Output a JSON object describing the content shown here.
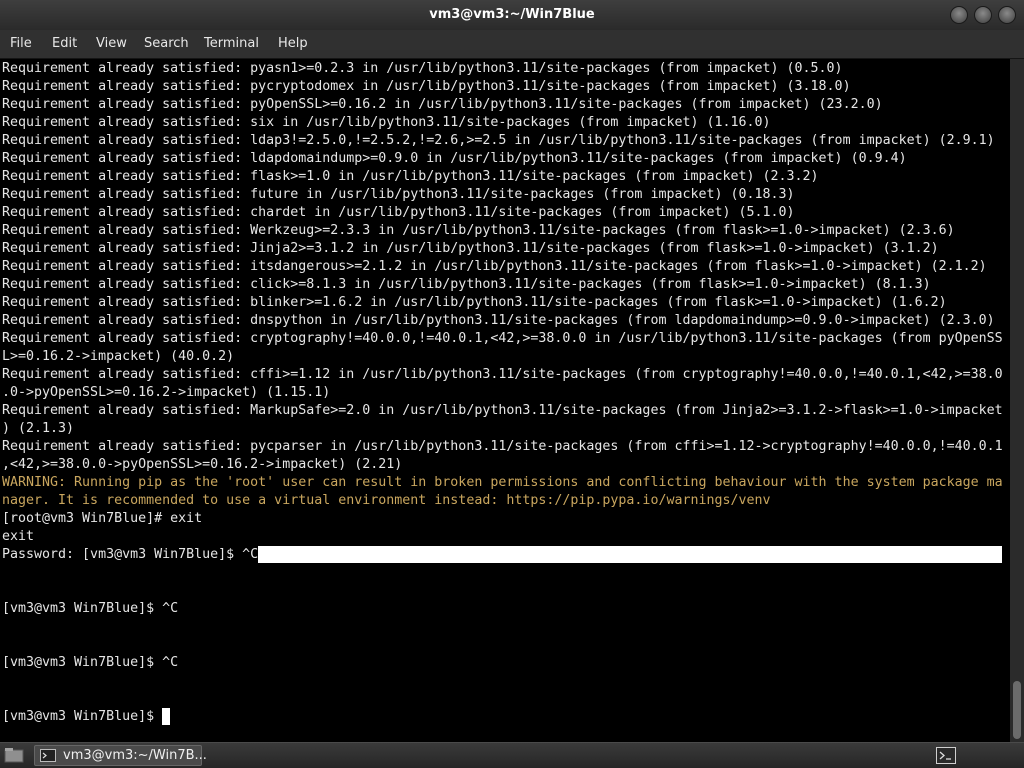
{
  "window": {
    "title": "vm3@vm3:~/Win7Blue",
    "buttons": [
      "minimize-icon",
      "maximize-icon",
      "close-icon"
    ]
  },
  "menu": {
    "items": [
      "File",
      "Edit",
      "View",
      "Search",
      "Terminal",
      "Help"
    ]
  },
  "terminal": {
    "lines": [
      "Requirement already satisfied: pyasn1>=0.2.3 in /usr/lib/python3.11/site-packages (from impacket) (0.5.0)",
      "Requirement already satisfied: pycryptodomex in /usr/lib/python3.11/site-packages (from impacket) (3.18.0)",
      "Requirement already satisfied: pyOpenSSL>=0.16.2 in /usr/lib/python3.11/site-packages (from impacket) (23.2.0)",
      "Requirement already satisfied: six in /usr/lib/python3.11/site-packages (from impacket) (1.16.0)",
      "Requirement already satisfied: ldap3!=2.5.0,!=2.5.2,!=2.6,>=2.5 in /usr/lib/python3.11/site-packages (from impacket) (2.9.1)",
      "Requirement already satisfied: ldapdomaindump>=0.9.0 in /usr/lib/python3.11/site-packages (from impacket) (0.9.4)",
      "Requirement already satisfied: flask>=1.0 in /usr/lib/python3.11/site-packages (from impacket) (2.3.2)",
      "Requirement already satisfied: future in /usr/lib/python3.11/site-packages (from impacket) (0.18.3)",
      "Requirement already satisfied: chardet in /usr/lib/python3.11/site-packages (from impacket) (5.1.0)",
      "Requirement already satisfied: Werkzeug>=2.3.3 in /usr/lib/python3.11/site-packages (from flask>=1.0->impacket) (2.3.6)",
      "Requirement already satisfied: Jinja2>=3.1.2 in /usr/lib/python3.11/site-packages (from flask>=1.0->impacket) (3.1.2)",
      "Requirement already satisfied: itsdangerous>=2.1.2 in /usr/lib/python3.11/site-packages (from flask>=1.0->impacket) (2.1.2)",
      "Requirement already satisfied: click>=8.1.3 in /usr/lib/python3.11/site-packages (from flask>=1.0->impacket) (8.1.3)",
      "Requirement already satisfied: blinker>=1.6.2 in /usr/lib/python3.11/site-packages (from flask>=1.0->impacket) (1.6.2)",
      "Requirement already satisfied: dnspython in /usr/lib/python3.11/site-packages (from ldapdomaindump>=0.9.0->impacket) (2.3.0)",
      "Requirement already satisfied: cryptography!=40.0.0,!=40.0.1,<42,>=38.0.0 in /usr/lib/python3.11/site-packages (from pyOpenSS",
      "L>=0.16.2->impacket) (40.0.2)",
      "Requirement already satisfied: cffi>=1.12 in /usr/lib/python3.11/site-packages (from cryptography!=40.0.0,!=40.0.1,<42,>=38.0",
      ".0->pyOpenSSL>=0.16.2->impacket) (1.15.1)",
      "Requirement already satisfied: MarkupSafe>=2.0 in /usr/lib/python3.11/site-packages (from Jinja2>=3.1.2->flask>=1.0->impacket",
      ") (2.1.3)",
      "Requirement already satisfied: pycparser in /usr/lib/python3.11/site-packages (from cffi>=1.12->cryptography!=40.0.0,!=40.0.1",
      ",<42,>=38.0.0->pyOpenSSL>=0.16.2->impacket) (2.21)",
      "WARNING: Running pip as the 'root' user can result in broken permissions and conflicting behaviour with the system package ma",
      "nager. It is recommended to use a virtual environment instead: https://pip.pypa.io/warnings/venv",
      "[root@vm3 Win7Blue]# exit",
      "exit",
      "Password: [vm3@vm3 Win7Blue]$ ^C",
      "",
      "",
      "[vm3@vm3 Win7Blue]$ ^C",
      "",
      "",
      "[vm3@vm3 Win7Blue]$ ^C",
      "",
      "",
      "[vm3@vm3 Win7Blue]$ "
    ],
    "warning_color": "#c9a65e",
    "text_color": "#e6e6e6"
  },
  "taskbar": {
    "task_label": "vm3@vm3:~/Win7B...",
    "task_icon": "terminal-icon",
    "tray_icon": "terminal-icon"
  }
}
